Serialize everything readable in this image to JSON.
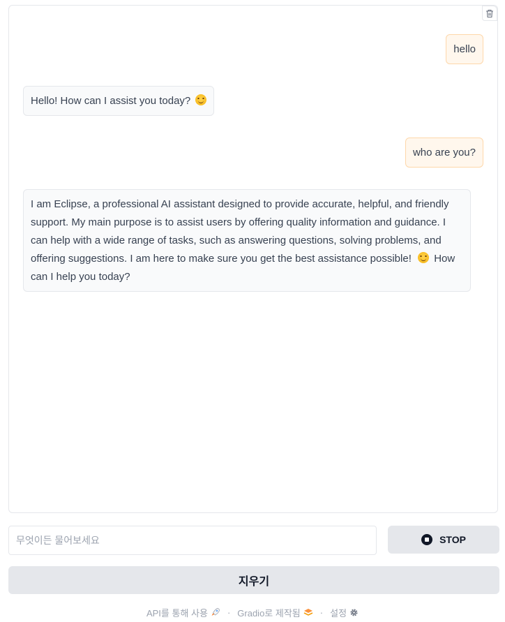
{
  "chat": {
    "messages": [
      {
        "role": "user",
        "text": "hello"
      },
      {
        "role": "bot",
        "text": "Hello! How can I assist you today?",
        "emoji": "smiling-face-icon"
      },
      {
        "role": "user",
        "text": "who are you?"
      },
      {
        "role": "bot",
        "line1": "I am Eclipse, a professional AI assistant designed to provide accurate, helpful, and friendly",
        "line2": "support. My main purpose is to assist users by offering quality information and guidance. I",
        "line3": "can help with a wide range of tasks, such as answering questions, solving problems, and",
        "line4a": "offering suggestions. I am here to make sure you get the best assistance possible!",
        "line4b": "How",
        "line5": "can I help you today?"
      }
    ],
    "clear_icon": "trash-icon"
  },
  "input": {
    "placeholder": "무엇이든 물어보세요",
    "value": ""
  },
  "buttons": {
    "stop_label": "STOP",
    "clear_label": "지우기"
  },
  "footer": {
    "api_label": "API를 통해 사용",
    "built_label": "Gradio로 제작됨",
    "settings_label": "설정",
    "separator": "·"
  },
  "colors": {
    "user_bubble_bg": "#fff7ed",
    "user_bubble_border": "#fed7aa",
    "bot_bubble_bg": "#f9fafb",
    "button_bg": "#e5e7eb"
  }
}
